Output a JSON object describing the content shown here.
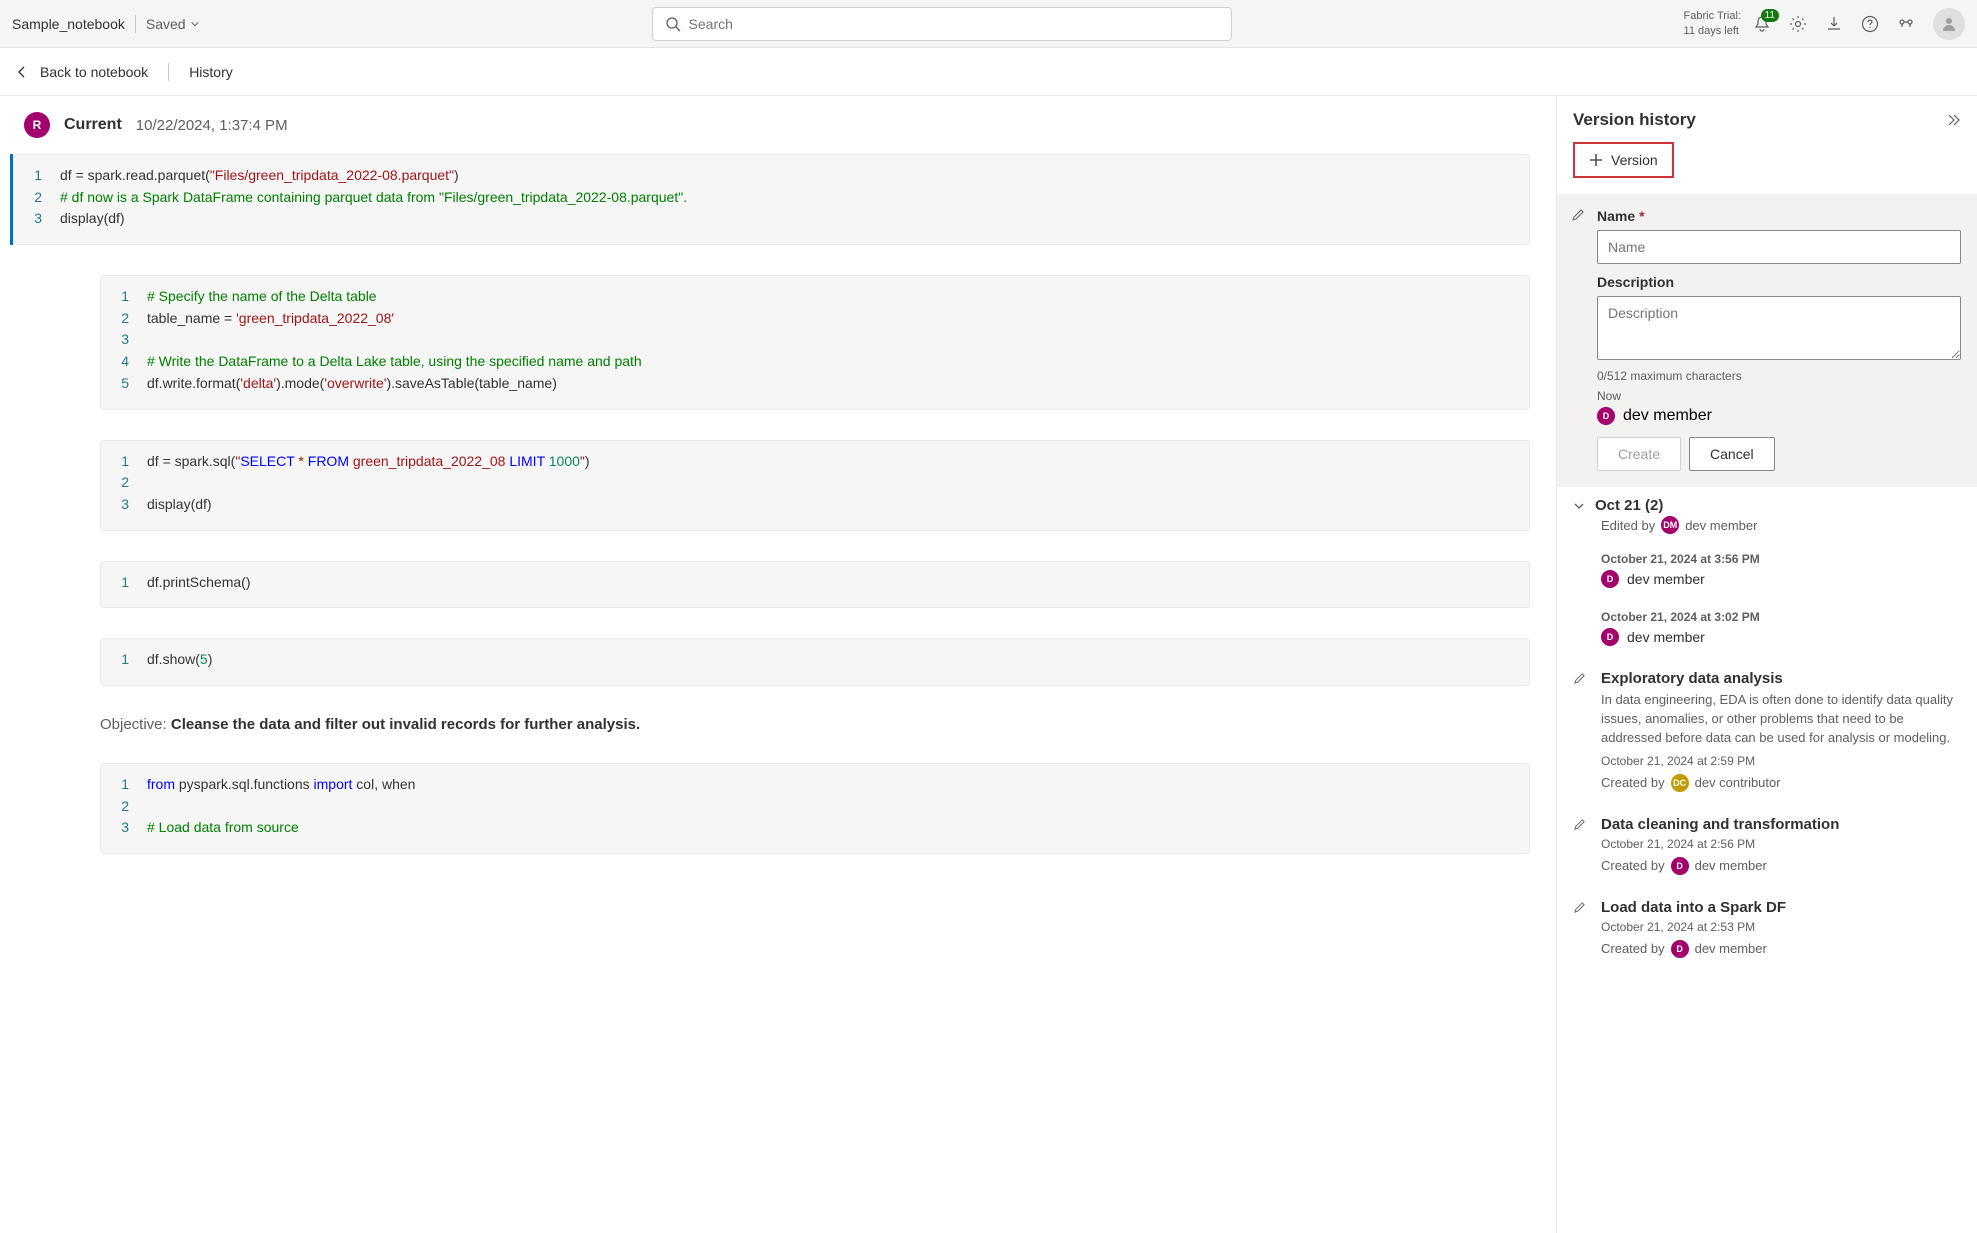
{
  "topbar": {
    "title": "Sample_notebook",
    "saved": "Saved",
    "search_placeholder": "Search",
    "trial_line1": "Fabric Trial:",
    "trial_line2": "11 days left",
    "notif_count": "11"
  },
  "secondbar": {
    "back": "Back to notebook",
    "history": "History"
  },
  "current": {
    "avatar": "R",
    "label": "Current",
    "timestamp": "10/22/2024, 1:37:4 PM"
  },
  "cells": [
    {
      "type": "code",
      "lines": [
        [
          {
            "t": "plain",
            "v": "df = spark.read.parquet("
          },
          {
            "t": "str",
            "v": "\"Files/green_tripdata_2022-08.parquet\""
          },
          {
            "t": "plain",
            "v": ")"
          }
        ],
        [
          {
            "t": "com",
            "v": "# df now is a Spark DataFrame containing parquet data from \"Files/green_tripdata_2022-08.parquet\"."
          }
        ],
        [
          {
            "t": "plain",
            "v": "display(df)"
          }
        ]
      ]
    },
    {
      "type": "code",
      "lines": [
        [
          {
            "t": "com",
            "v": "# Specify the name of the Delta table"
          }
        ],
        [
          {
            "t": "plain",
            "v": "table_name = "
          },
          {
            "t": "str",
            "v": "'green_tripdata_2022_08'"
          }
        ],
        [
          {
            "t": "plain",
            "v": ""
          }
        ],
        [
          {
            "t": "com",
            "v": "# Write the DataFrame to a Delta Lake table, using the specified name and path"
          }
        ],
        [
          {
            "t": "plain",
            "v": "df.write.format("
          },
          {
            "t": "str",
            "v": "'delta'"
          },
          {
            "t": "plain",
            "v": ").mode("
          },
          {
            "t": "str",
            "v": "'overwrite'"
          },
          {
            "t": "plain",
            "v": ").saveAsTable(table_name)"
          }
        ]
      ]
    },
    {
      "type": "code",
      "lines": [
        [
          {
            "t": "plain",
            "v": "df = spark.sql("
          },
          {
            "t": "str",
            "v": "\""
          },
          {
            "t": "sql",
            "v": "SELECT"
          },
          {
            "t": "str",
            "v": " * "
          },
          {
            "t": "sql",
            "v": "FROM"
          },
          {
            "t": "str",
            "v": " green_tripdata_2022_08 "
          },
          {
            "t": "sql",
            "v": "LIMIT"
          },
          {
            "t": "str",
            "v": " "
          },
          {
            "t": "num",
            "v": "1000"
          },
          {
            "t": "str",
            "v": "\""
          },
          {
            "t": "plain",
            "v": ")"
          }
        ],
        [
          {
            "t": "plain",
            "v": ""
          }
        ],
        [
          {
            "t": "plain",
            "v": "display(df)"
          }
        ]
      ]
    },
    {
      "type": "code",
      "lines": [
        [
          {
            "t": "plain",
            "v": "df.printSchema()"
          }
        ]
      ]
    },
    {
      "type": "code",
      "lines": [
        [
          {
            "t": "plain",
            "v": "df.show("
          },
          {
            "t": "num",
            "v": "5"
          },
          {
            "t": "plain",
            "v": ")"
          }
        ]
      ]
    },
    {
      "type": "markdown",
      "objective_label": "Objective: ",
      "objective_text": "Cleanse the data and filter out invalid records for further analysis."
    },
    {
      "type": "code",
      "lines": [
        [
          {
            "t": "kw",
            "v": "from"
          },
          {
            "t": "plain",
            "v": " pyspark.sql.functions "
          },
          {
            "t": "kw",
            "v": "import"
          },
          {
            "t": "plain",
            "v": " col, when"
          }
        ],
        [
          {
            "t": "plain",
            "v": ""
          }
        ],
        [
          {
            "t": "com",
            "v": "# Load data from source"
          }
        ]
      ]
    }
  ],
  "panel": {
    "title": "Version history",
    "version_btn": "Version",
    "form": {
      "name_label": "Name",
      "name_placeholder": "Name",
      "desc_label": "Description",
      "desc_placeholder": "Description",
      "hint": "0/512 maximum characters",
      "now": "Now",
      "user": "dev member",
      "create": "Create",
      "cancel": "Cancel"
    },
    "group": {
      "title": "Oct 21 (2)",
      "edited_by": "Edited by",
      "editor": "dev member"
    },
    "autosaves": [
      {
        "ts": "October 21, 2024 at 3:56 PM",
        "user": "dev member"
      },
      {
        "ts": "October 21, 2024 at 3:02 PM",
        "user": "dev member"
      }
    ],
    "named": [
      {
        "title": "Exploratory data analysis",
        "desc": "In data engineering, EDA is often done to identify data quality issues, anomalies, or other problems that need to be addressed before data can be used for analysis or modeling.",
        "ts": "October 21, 2024 at 2:59 PM",
        "created_by": "Created by",
        "user": "dev contributor",
        "avatar_class": "dc",
        "avatar": "DC"
      },
      {
        "title": "Data cleaning and transformation",
        "desc": "",
        "ts": "October 21, 2024 at 2:56 PM",
        "created_by": "Created by",
        "user": "dev member",
        "avatar_class": "dm",
        "avatar": "D"
      },
      {
        "title": "Load data into a Spark DF",
        "desc": "",
        "ts": "October 21, 2024 at 2:53 PM",
        "created_by": "Created by",
        "user": "dev member",
        "avatar_class": "dm",
        "avatar": "D"
      }
    ]
  }
}
